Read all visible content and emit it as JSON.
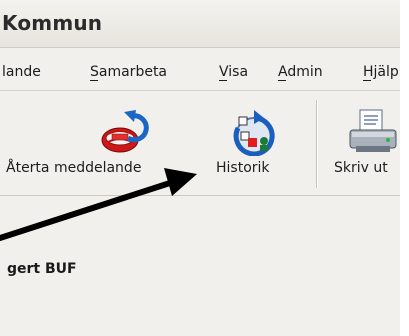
{
  "window": {
    "title": "Kommun"
  },
  "menubar": {
    "items": [
      {
        "label": "lande"
      },
      {
        "label": "Samarbeta"
      },
      {
        "label": "Visa"
      },
      {
        "label": "Admin"
      },
      {
        "label": "Hjälp"
      }
    ]
  },
  "toolbar": {
    "buttons": [
      {
        "label": "Återta meddelande",
        "icon": "recall-message-icon"
      },
      {
        "label": "Historik",
        "icon": "history-icon"
      },
      {
        "label": "Skriv ut",
        "icon": "printer-icon"
      }
    ]
  },
  "content": {
    "title": "gert BUF"
  },
  "annotation": {
    "arrow_color": "#000000"
  }
}
